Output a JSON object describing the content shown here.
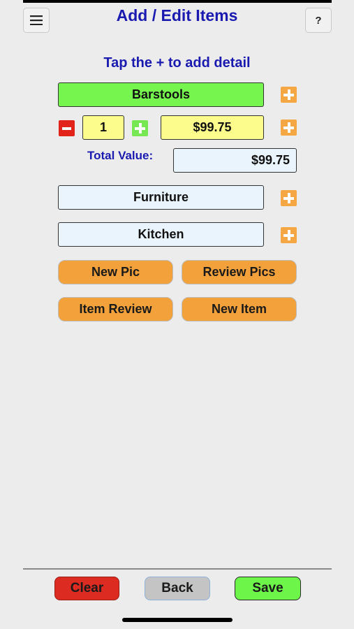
{
  "header": {
    "title": "Add / Edit Items",
    "menu_icon": "hamburger-menu-icon",
    "help_label": "?"
  },
  "instruction": "Tap the + to add detail",
  "item": {
    "name": "Barstools",
    "quantity": "1",
    "unit_price": "$99.75",
    "total_label": "Total Value:",
    "total_value": "$99.75",
    "category": "Furniture",
    "location": "Kitchen"
  },
  "actions": {
    "new_pic": "New Pic",
    "review_pics": "Review Pics",
    "item_review": "Item Review",
    "new_item": "New Item"
  },
  "footer": {
    "clear": "Clear",
    "back": "Back",
    "save": "Save"
  },
  "colors": {
    "title": "#1a1ab0",
    "name_field": "#76f54e",
    "yellow_field": "#fcfc8c",
    "blue_field": "#e9f4fc",
    "orange": "#f3a13a",
    "clear": "#dc2b21",
    "back": "#c4c4c4",
    "save": "#6df54a"
  }
}
